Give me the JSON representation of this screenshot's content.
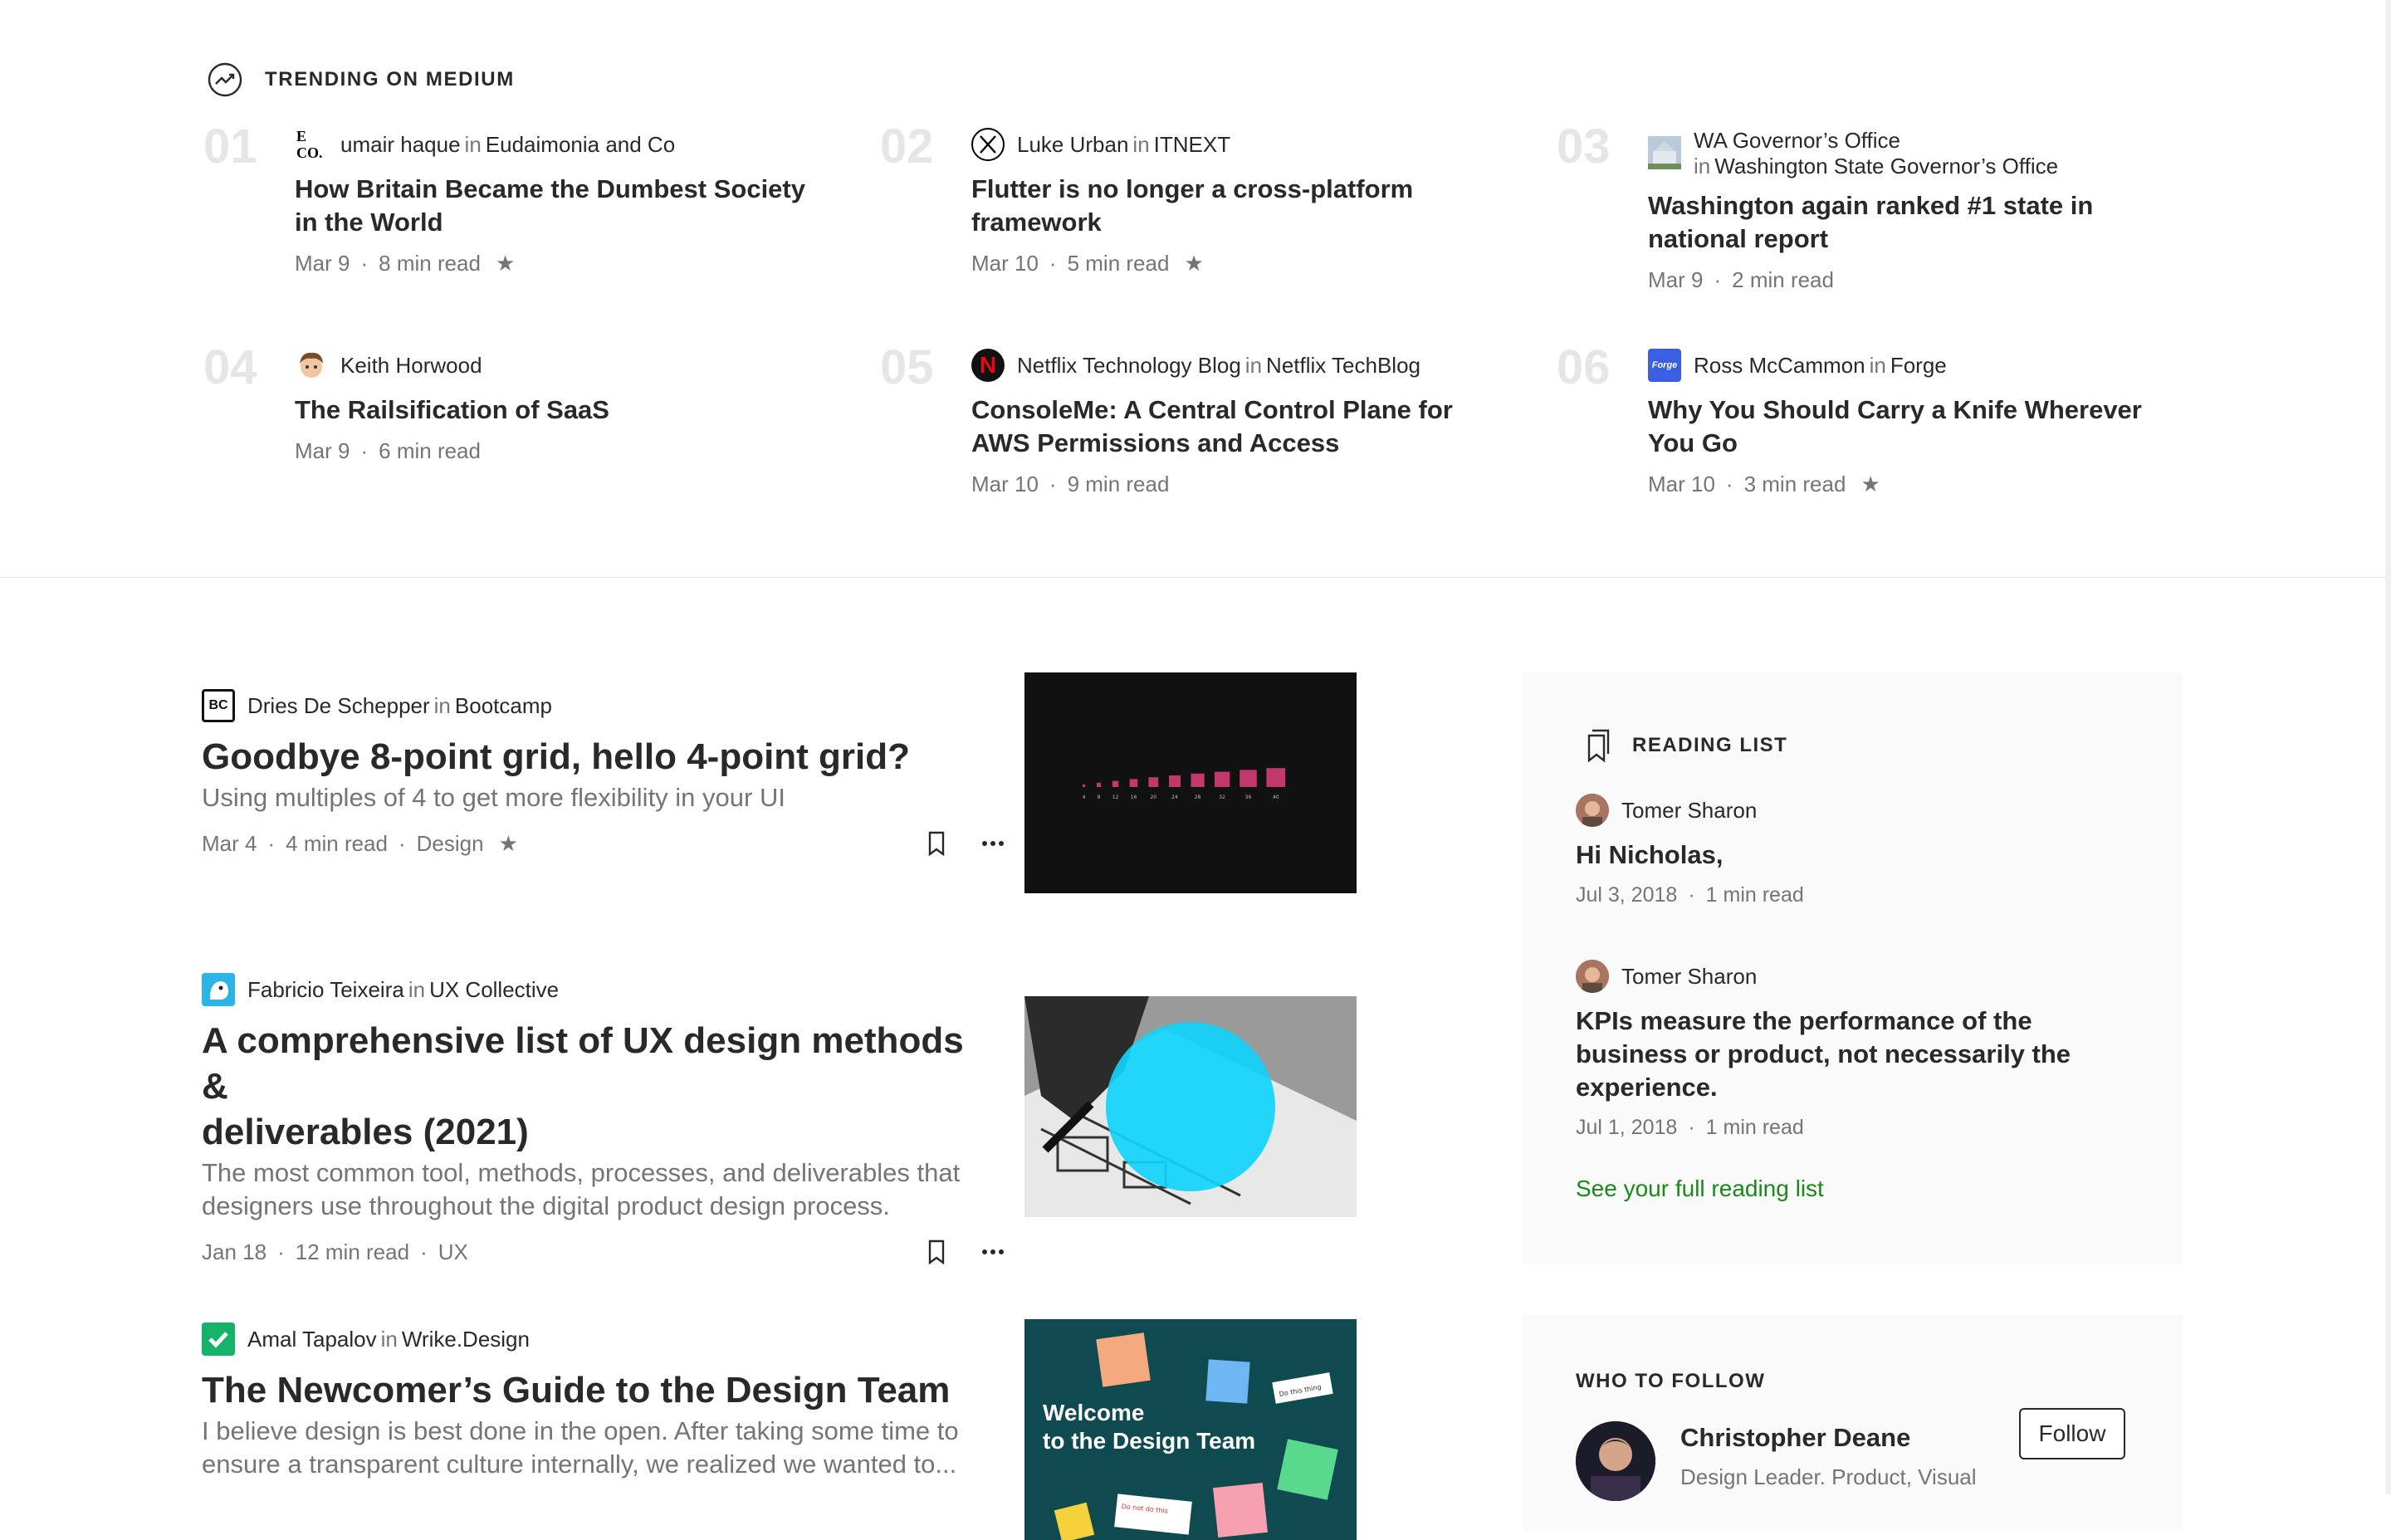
{
  "trending": {
    "header": "TRENDING ON MEDIUM",
    "items": [
      {
        "num": "01",
        "author": "umair haque",
        "in": "in",
        "publication": "Eudaimonia and Co",
        "title_l1": "How Britain Became the Dumbest Society",
        "title_l2": "in the World",
        "date": "Mar 9",
        "read": "8 min read",
        "star": "★",
        "avatar_text": "E CO."
      },
      {
        "num": "02",
        "author": "Luke Urban",
        "in": "in",
        "publication": "ITNEXT",
        "title_l1": "Flutter is no longer a cross-platform",
        "title_l2": "framework",
        "date": "Mar 10",
        "read": "5 min read",
        "star": "★",
        "avatar_text": "X"
      },
      {
        "num": "03",
        "author": "WA Governor’s Office",
        "in": "in",
        "publication": "Washington State Governor’s Office",
        "title_l1": "Washington again ranked #1 state in",
        "title_l2": "national report",
        "date": "Mar 9",
        "read": "2 min read",
        "star": ""
      },
      {
        "num": "04",
        "author": "Keith Horwood",
        "in": "",
        "publication": "",
        "title_l1": "The Railsification of SaaS",
        "title_l2": "",
        "date": "Mar 9",
        "read": "6 min read",
        "star": ""
      },
      {
        "num": "05",
        "author": "Netflix Technology Blog",
        "in": "in",
        "publication": "Netflix TechBlog",
        "title_l1": "ConsoleMe: A Central Control Plane for",
        "title_l2": "AWS Permissions and Access",
        "date": "Mar 10",
        "read": "9 min read",
        "star": "",
        "avatar_text": "N"
      },
      {
        "num": "06",
        "author": "Ross McCammon",
        "in": "in",
        "publication": "Forge",
        "title_l1": "Why You Should Carry a Knife Wherever",
        "title_l2": "You Go",
        "date": "Mar 10",
        "read": "3 min read",
        "star": "★",
        "avatar_text": "Forge"
      }
    ]
  },
  "posts": [
    {
      "author": "Dries De Schepper",
      "in": "in",
      "publication": "Bootcamp",
      "title_l1": "Goodbye 8-point grid, hello 4-point grid?",
      "title_l2": "",
      "sub_l1": "Using multiples of 4 to get more flexibility in your UI",
      "sub_l2": "",
      "date": "Mar 4",
      "read": "4 min read",
      "tag": "Design",
      "star": "★",
      "avatar_text": "BC"
    },
    {
      "author": "Fabricio Teixeira",
      "in": "in",
      "publication": "UX Collective",
      "title_l1": "A comprehensive list of UX design methods &",
      "title_l2": "deliverables (2021)",
      "sub_l1": "The most common tool, methods, processes, and deliverables that",
      "sub_l2": "designers use throughout the digital product design process.",
      "date": "Jan 18",
      "read": "12 min read",
      "tag": "UX",
      "star": ""
    },
    {
      "author": "Amal Tapalov",
      "in": "in",
      "publication": "Wrike.Design",
      "title_l1": "The Newcomer’s Guide to the Design Team",
      "title_l2": "",
      "sub_l1": "I believe design is best done in the open. After taking some time to",
      "sub_l2": "ensure a transparent culture internally, we realized we wanted to...",
      "date": "",
      "read": "",
      "tag": "",
      "star": ""
    }
  ],
  "thumb3": {
    "line1": "Welcome",
    "line2": "to the Design Team",
    "note1": "Do not do this",
    "note2": "Do this thing"
  },
  "thumb1_labels": [
    "4",
    "8",
    "12",
    "16",
    "20",
    "24",
    "28",
    "32",
    "36",
    "40"
  ],
  "reading_list": {
    "header": "READING LIST",
    "items": [
      {
        "author": "Tomer Sharon",
        "title_l1": "Hi Nicholas,",
        "title_l2": "",
        "title_l3": "",
        "date": "Jul 3, 2018",
        "read": "1 min read"
      },
      {
        "author": "Tomer Sharon",
        "title_l1": "KPIs measure the performance of the",
        "title_l2": "business or product, not necessarily the",
        "title_l3": "experience.",
        "date": "Jul 1, 2018",
        "read": "1 min read"
      }
    ],
    "see_full": "See your full reading list"
  },
  "who_to_follow": {
    "header": "WHO TO FOLLOW",
    "name": "Christopher Deane",
    "bio": "Design Leader. Product, Visual",
    "follow": "Follow"
  },
  "colors": {
    "accent_green": "#1a8917",
    "text": "#292929",
    "muted": "#757575",
    "rank_num": "#e6e6e6"
  }
}
